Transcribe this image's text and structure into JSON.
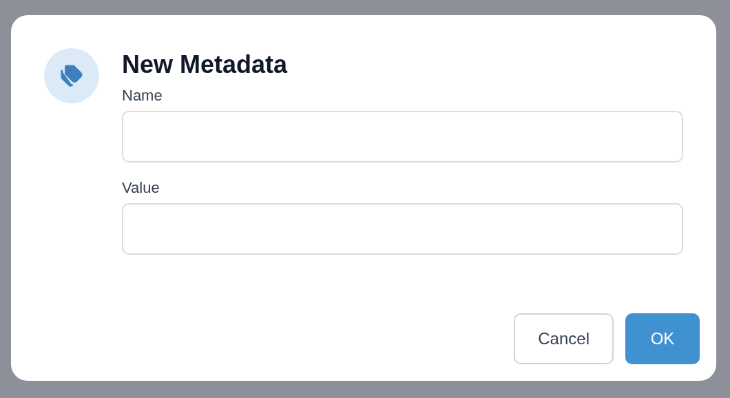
{
  "dialog": {
    "title": "New Metadata",
    "fields": [
      {
        "label": "Name"
      },
      {
        "label": "Value"
      }
    ],
    "buttons": [
      {
        "label": "Cancel",
        "kind": "secondary"
      },
      {
        "label": "OK",
        "kind": "primary"
      }
    ]
  }
}
